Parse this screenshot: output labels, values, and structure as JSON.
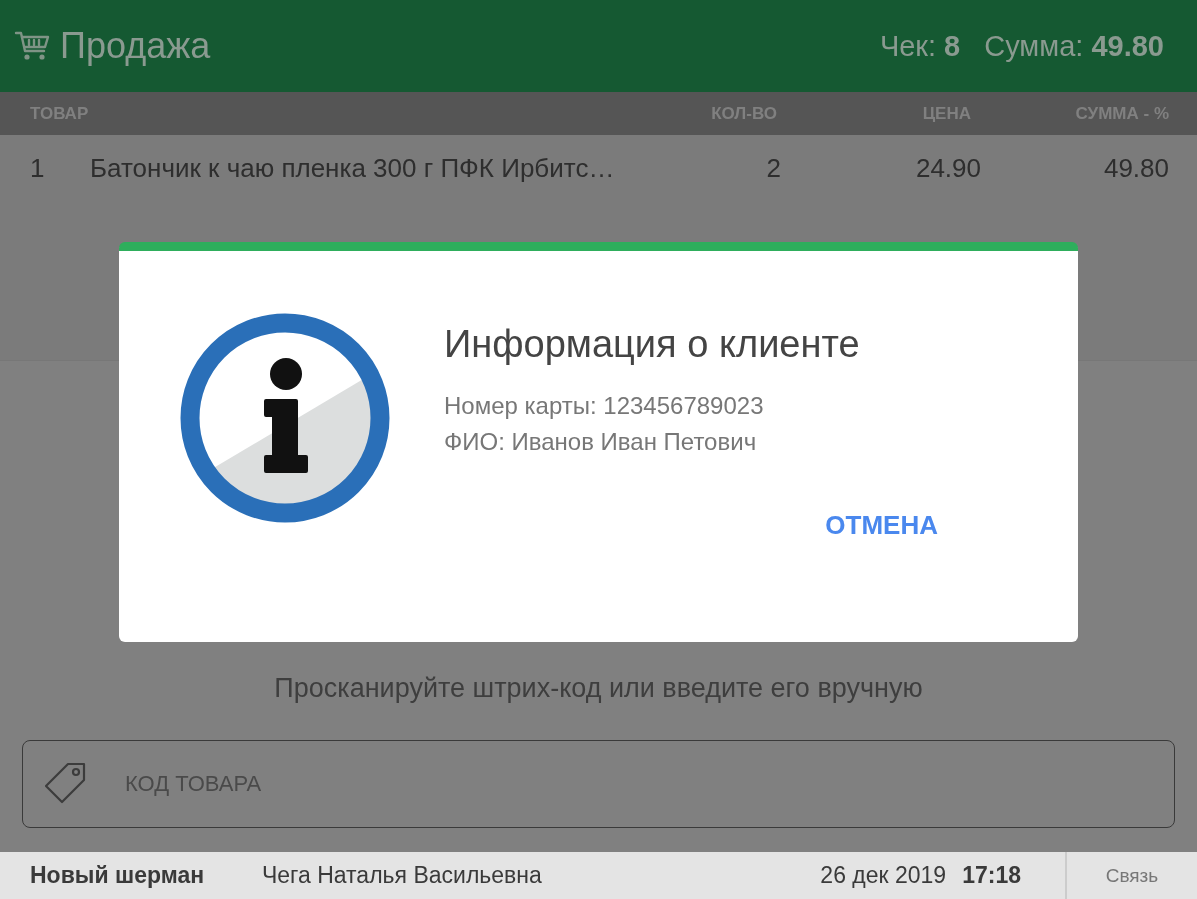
{
  "header": {
    "title": "Продажа",
    "receipt_label": "Чек:",
    "receipt_number": "8",
    "total_label": "Сумма:",
    "total_value": "49.80"
  },
  "table": {
    "columns": [
      "ТОВАР",
      "КОЛ-ВО",
      "ЦЕНА",
      "СУММА - %"
    ],
    "rows": [
      {
        "index": "1",
        "name": "Батончик к чаю пленка 300 г ПФК Ирбитс…",
        "quantity": "2",
        "price": "24.90",
        "sum": "49.80"
      }
    ]
  },
  "prompt": "Просканируйте штрих-код или введите его вручную",
  "barcode_field": {
    "placeholder": "КОД ТОВАРА"
  },
  "status_bar": {
    "store": "Новый шерман",
    "cashier": "Чега Наталья Васильевна",
    "date": "26 дек 2019",
    "time": "17:18",
    "connection": "Связь"
  },
  "dialog": {
    "title": "Информация о клиенте",
    "lines": [
      "Номер карты: 123456789023",
      "ФИО: Иванов Иван Петович"
    ],
    "buttons": [
      "ОТМЕНА"
    ]
  }
}
